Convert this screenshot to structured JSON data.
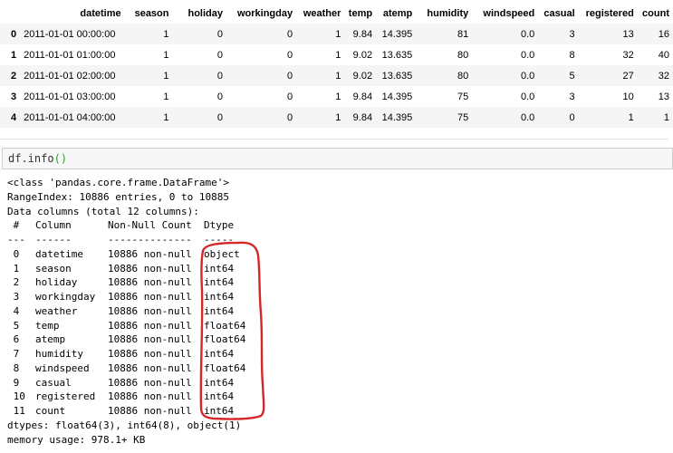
{
  "dataframe": {
    "columns": [
      "datetime",
      "season",
      "holiday",
      "workingday",
      "weather",
      "temp",
      "atemp",
      "humidity",
      "windspeed",
      "casual",
      "registered",
      "count"
    ],
    "rows": [
      {
        "index": "0",
        "datetime": "2011-01-01 00:00:00",
        "season": "1",
        "holiday": "0",
        "workingday": "0",
        "weather": "1",
        "temp": "9.84",
        "atemp": "14.395",
        "humidity": "81",
        "windspeed": "0.0",
        "casual": "3",
        "registered": "13",
        "count": "16"
      },
      {
        "index": "1",
        "datetime": "2011-01-01 01:00:00",
        "season": "1",
        "holiday": "0",
        "workingday": "0",
        "weather": "1",
        "temp": "9.02",
        "atemp": "13.635",
        "humidity": "80",
        "windspeed": "0.0",
        "casual": "8",
        "registered": "32",
        "count": "40"
      },
      {
        "index": "2",
        "datetime": "2011-01-01 02:00:00",
        "season": "1",
        "holiday": "0",
        "workingday": "0",
        "weather": "1",
        "temp": "9.02",
        "atemp": "13.635",
        "humidity": "80",
        "windspeed": "0.0",
        "casual": "5",
        "registered": "27",
        "count": "32"
      },
      {
        "index": "3",
        "datetime": "2011-01-01 03:00:00",
        "season": "1",
        "holiday": "0",
        "workingday": "0",
        "weather": "1",
        "temp": "9.84",
        "atemp": "14.395",
        "humidity": "75",
        "windspeed": "0.0",
        "casual": "3",
        "registered": "10",
        "count": "13"
      },
      {
        "index": "4",
        "datetime": "2011-01-01 04:00:00",
        "season": "1",
        "holiday": "0",
        "workingday": "0",
        "weather": "1",
        "temp": "9.84",
        "atemp": "14.395",
        "humidity": "75",
        "windspeed": "0.0",
        "casual": "0",
        "registered": "1",
        "count": "1"
      }
    ]
  },
  "code_cell": {
    "function": "df.info",
    "open_paren": "(",
    "close_paren": ")"
  },
  "info_output": {
    "class_line": "<class 'pandas.core.frame.DataFrame'>",
    "range_index": "RangeIndex: 10886 entries, 0 to 10885",
    "data_columns": "Data columns (total 12 columns):",
    "header": {
      "num": " #",
      "column": "Column",
      "non_null": "Non-Null Count",
      "dtype": "Dtype"
    },
    "underline": {
      "num": "---",
      "column": "------",
      "non_null": "--------------",
      "dtype": "-----"
    },
    "columns": [
      {
        "num": " 0",
        "name": "datetime",
        "non_null": "10886 non-null",
        "dtype": "object"
      },
      {
        "num": " 1",
        "name": "season",
        "non_null": "10886 non-null",
        "dtype": "int64"
      },
      {
        "num": " 2",
        "name": "holiday",
        "non_null": "10886 non-null",
        "dtype": "int64"
      },
      {
        "num": " 3",
        "name": "workingday",
        "non_null": "10886 non-null",
        "dtype": "int64"
      },
      {
        "num": " 4",
        "name": "weather",
        "non_null": "10886 non-null",
        "dtype": "int64"
      },
      {
        "num": " 5",
        "name": "temp",
        "non_null": "10886 non-null",
        "dtype": "float64"
      },
      {
        "num": " 6",
        "name": "atemp",
        "non_null": "10886 non-null",
        "dtype": "float64"
      },
      {
        "num": " 7",
        "name": "humidity",
        "non_null": "10886 non-null",
        "dtype": "int64"
      },
      {
        "num": " 8",
        "name": "windspeed",
        "non_null": "10886 non-null",
        "dtype": "float64"
      },
      {
        "num": " 9",
        "name": "casual",
        "non_null": "10886 non-null",
        "dtype": "int64"
      },
      {
        "num": " 10",
        "name": "registered",
        "non_null": "10886 non-null",
        "dtype": "int64"
      },
      {
        "num": " 11",
        "name": "count",
        "non_null": "10886 non-null",
        "dtype": "int64"
      }
    ],
    "dtypes_line": "dtypes: float64(3), int64(8), object(1)",
    "memory_line": "memory usage: 978.1+ KB"
  },
  "colors": {
    "annotation": "#d62728",
    "paren": "#2ca02c",
    "row_stripe": "#f5f5f5",
    "code_bg": "#f7f7f7"
  }
}
